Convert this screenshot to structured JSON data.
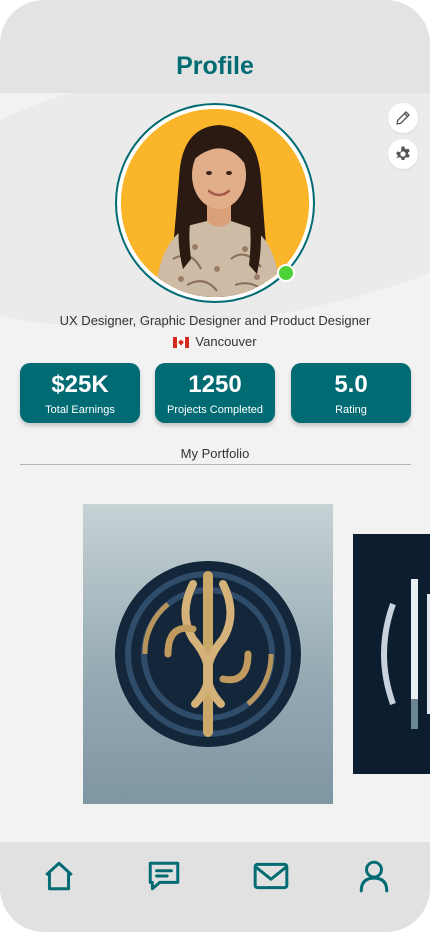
{
  "header": {
    "title": "Profile"
  },
  "actions": {
    "edit_icon": "pencil-icon",
    "settings_icon": "gear-icon"
  },
  "profile": {
    "tagline": "UX Designer, Graphic Designer and Product Designer",
    "location": "Vancouver",
    "flag": "canada-flag",
    "online": true
  },
  "stats": [
    {
      "value": "$25K",
      "label": "Total Earnings"
    },
    {
      "value": "1250",
      "label": "Projects Completed"
    },
    {
      "value": "5.0",
      "label": "Rating"
    }
  ],
  "portfolio": {
    "title": "My Portfolio"
  },
  "nav": {
    "items": [
      {
        "icon": "home-icon"
      },
      {
        "icon": "chat-icon"
      },
      {
        "icon": "mail-icon"
      },
      {
        "icon": "user-icon"
      }
    ]
  },
  "colors": {
    "accent": "#006b73",
    "online": "#4cd137",
    "avatar_bg": "#fbb52a"
  }
}
